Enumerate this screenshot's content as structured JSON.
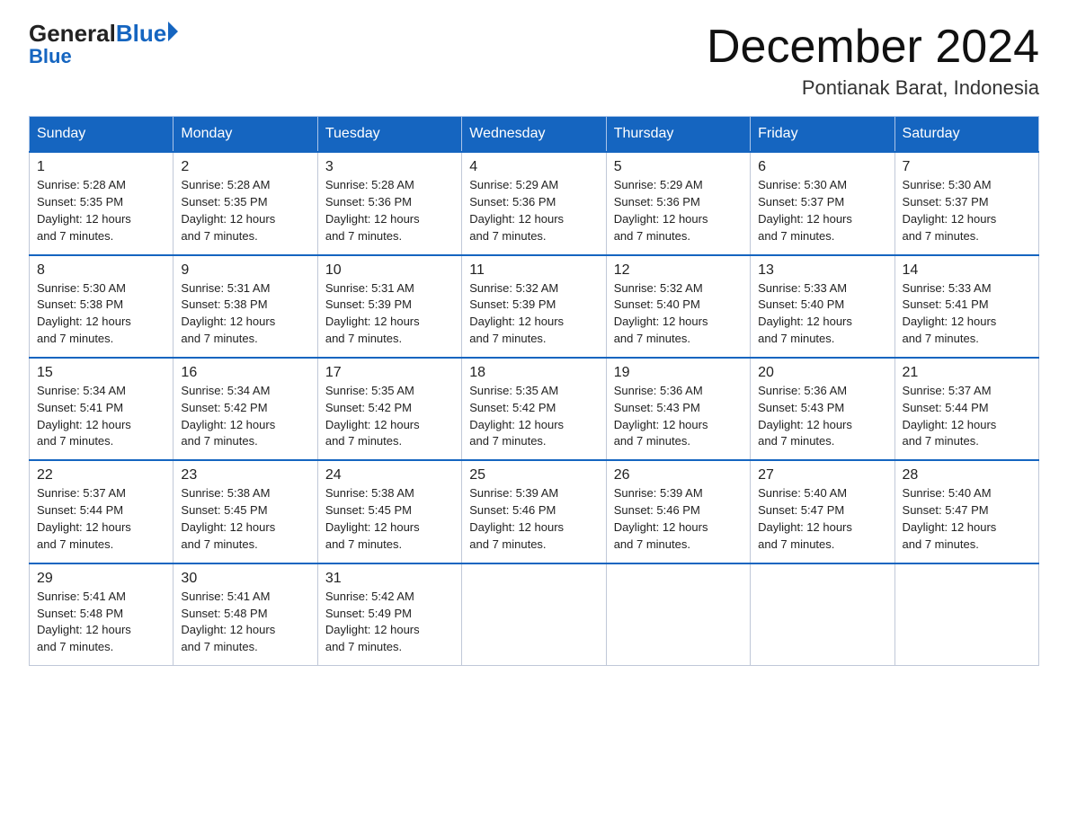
{
  "logo": {
    "general": "General",
    "blue": "Blue",
    "sub": "Blue"
  },
  "title": "December 2024",
  "subtitle": "Pontianak Barat, Indonesia",
  "headers": [
    "Sunday",
    "Monday",
    "Tuesday",
    "Wednesday",
    "Thursday",
    "Friday",
    "Saturday"
  ],
  "weeks": [
    [
      {
        "day": "1",
        "sunrise": "5:28 AM",
        "sunset": "5:35 PM",
        "daylight": "12 hours and 7 minutes."
      },
      {
        "day": "2",
        "sunrise": "5:28 AM",
        "sunset": "5:35 PM",
        "daylight": "12 hours and 7 minutes."
      },
      {
        "day": "3",
        "sunrise": "5:28 AM",
        "sunset": "5:36 PM",
        "daylight": "12 hours and 7 minutes."
      },
      {
        "day": "4",
        "sunrise": "5:29 AM",
        "sunset": "5:36 PM",
        "daylight": "12 hours and 7 minutes."
      },
      {
        "day": "5",
        "sunrise": "5:29 AM",
        "sunset": "5:36 PM",
        "daylight": "12 hours and 7 minutes."
      },
      {
        "day": "6",
        "sunrise": "5:30 AM",
        "sunset": "5:37 PM",
        "daylight": "12 hours and 7 minutes."
      },
      {
        "day": "7",
        "sunrise": "5:30 AM",
        "sunset": "5:37 PM",
        "daylight": "12 hours and 7 minutes."
      }
    ],
    [
      {
        "day": "8",
        "sunrise": "5:30 AM",
        "sunset": "5:38 PM",
        "daylight": "12 hours and 7 minutes."
      },
      {
        "day": "9",
        "sunrise": "5:31 AM",
        "sunset": "5:38 PM",
        "daylight": "12 hours and 7 minutes."
      },
      {
        "day": "10",
        "sunrise": "5:31 AM",
        "sunset": "5:39 PM",
        "daylight": "12 hours and 7 minutes."
      },
      {
        "day": "11",
        "sunrise": "5:32 AM",
        "sunset": "5:39 PM",
        "daylight": "12 hours and 7 minutes."
      },
      {
        "day": "12",
        "sunrise": "5:32 AM",
        "sunset": "5:40 PM",
        "daylight": "12 hours and 7 minutes."
      },
      {
        "day": "13",
        "sunrise": "5:33 AM",
        "sunset": "5:40 PM",
        "daylight": "12 hours and 7 minutes."
      },
      {
        "day": "14",
        "sunrise": "5:33 AM",
        "sunset": "5:41 PM",
        "daylight": "12 hours and 7 minutes."
      }
    ],
    [
      {
        "day": "15",
        "sunrise": "5:34 AM",
        "sunset": "5:41 PM",
        "daylight": "12 hours and 7 minutes."
      },
      {
        "day": "16",
        "sunrise": "5:34 AM",
        "sunset": "5:42 PM",
        "daylight": "12 hours and 7 minutes."
      },
      {
        "day": "17",
        "sunrise": "5:35 AM",
        "sunset": "5:42 PM",
        "daylight": "12 hours and 7 minutes."
      },
      {
        "day": "18",
        "sunrise": "5:35 AM",
        "sunset": "5:42 PM",
        "daylight": "12 hours and 7 minutes."
      },
      {
        "day": "19",
        "sunrise": "5:36 AM",
        "sunset": "5:43 PM",
        "daylight": "12 hours and 7 minutes."
      },
      {
        "day": "20",
        "sunrise": "5:36 AM",
        "sunset": "5:43 PM",
        "daylight": "12 hours and 7 minutes."
      },
      {
        "day": "21",
        "sunrise": "5:37 AM",
        "sunset": "5:44 PM",
        "daylight": "12 hours and 7 minutes."
      }
    ],
    [
      {
        "day": "22",
        "sunrise": "5:37 AM",
        "sunset": "5:44 PM",
        "daylight": "12 hours and 7 minutes."
      },
      {
        "day": "23",
        "sunrise": "5:38 AM",
        "sunset": "5:45 PM",
        "daylight": "12 hours and 7 minutes."
      },
      {
        "day": "24",
        "sunrise": "5:38 AM",
        "sunset": "5:45 PM",
        "daylight": "12 hours and 7 minutes."
      },
      {
        "day": "25",
        "sunrise": "5:39 AM",
        "sunset": "5:46 PM",
        "daylight": "12 hours and 7 minutes."
      },
      {
        "day": "26",
        "sunrise": "5:39 AM",
        "sunset": "5:46 PM",
        "daylight": "12 hours and 7 minutes."
      },
      {
        "day": "27",
        "sunrise": "5:40 AM",
        "sunset": "5:47 PM",
        "daylight": "12 hours and 7 minutes."
      },
      {
        "day": "28",
        "sunrise": "5:40 AM",
        "sunset": "5:47 PM",
        "daylight": "12 hours and 7 minutes."
      }
    ],
    [
      {
        "day": "29",
        "sunrise": "5:41 AM",
        "sunset": "5:48 PM",
        "daylight": "12 hours and 7 minutes."
      },
      {
        "day": "30",
        "sunrise": "5:41 AM",
        "sunset": "5:48 PM",
        "daylight": "12 hours and 7 minutes."
      },
      {
        "day": "31",
        "sunrise": "5:42 AM",
        "sunset": "5:49 PM",
        "daylight": "12 hours and 7 minutes."
      },
      null,
      null,
      null,
      null
    ]
  ]
}
